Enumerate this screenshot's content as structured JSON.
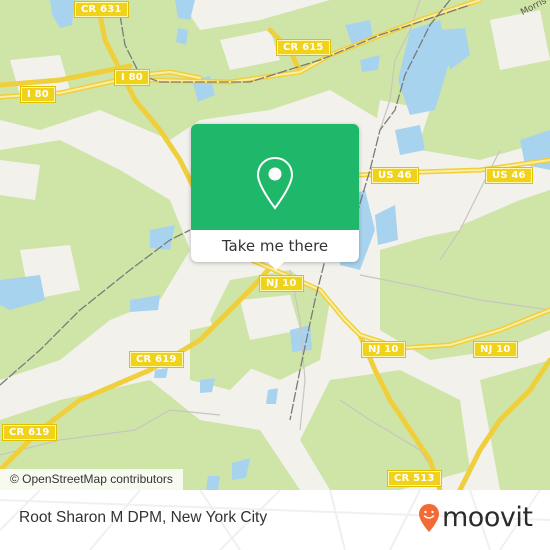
{
  "map": {
    "road_labels": [
      {
        "id": "cr631",
        "text": "CR 631"
      },
      {
        "id": "i80-a",
        "text": "I 80"
      },
      {
        "id": "i80-b",
        "text": "I 80"
      },
      {
        "id": "cr615",
        "text": "CR 615"
      },
      {
        "id": "us46-a",
        "text": "US 46"
      },
      {
        "id": "us46-b",
        "text": "US 46"
      },
      {
        "id": "nj10-a",
        "text": "NJ 10"
      },
      {
        "id": "nj10-b",
        "text": "NJ 10"
      },
      {
        "id": "nj10-c",
        "text": "NJ 10"
      },
      {
        "id": "cr619-a",
        "text": "CR 619"
      },
      {
        "id": "cr619-b",
        "text": "CR 619"
      },
      {
        "id": "cr513",
        "text": "CR 513"
      }
    ],
    "street_label": "Morris",
    "attribution": "© OpenStreetMap contributors",
    "colors": {
      "land": "#f2f1ec",
      "forest": "#cfe5a8",
      "water": "#a8d3ef",
      "road": "#f5d94c",
      "rail": "#777777"
    }
  },
  "popup": {
    "icon": "location-pin-icon",
    "button_label": "Take me there",
    "color": "#1fb76a"
  },
  "footer": {
    "place_title": "Root Sharon M DPM, New York City",
    "brand": "moovit",
    "brand_icon": "moovit-pin-smile-icon",
    "brand_color": "#f26a35"
  }
}
